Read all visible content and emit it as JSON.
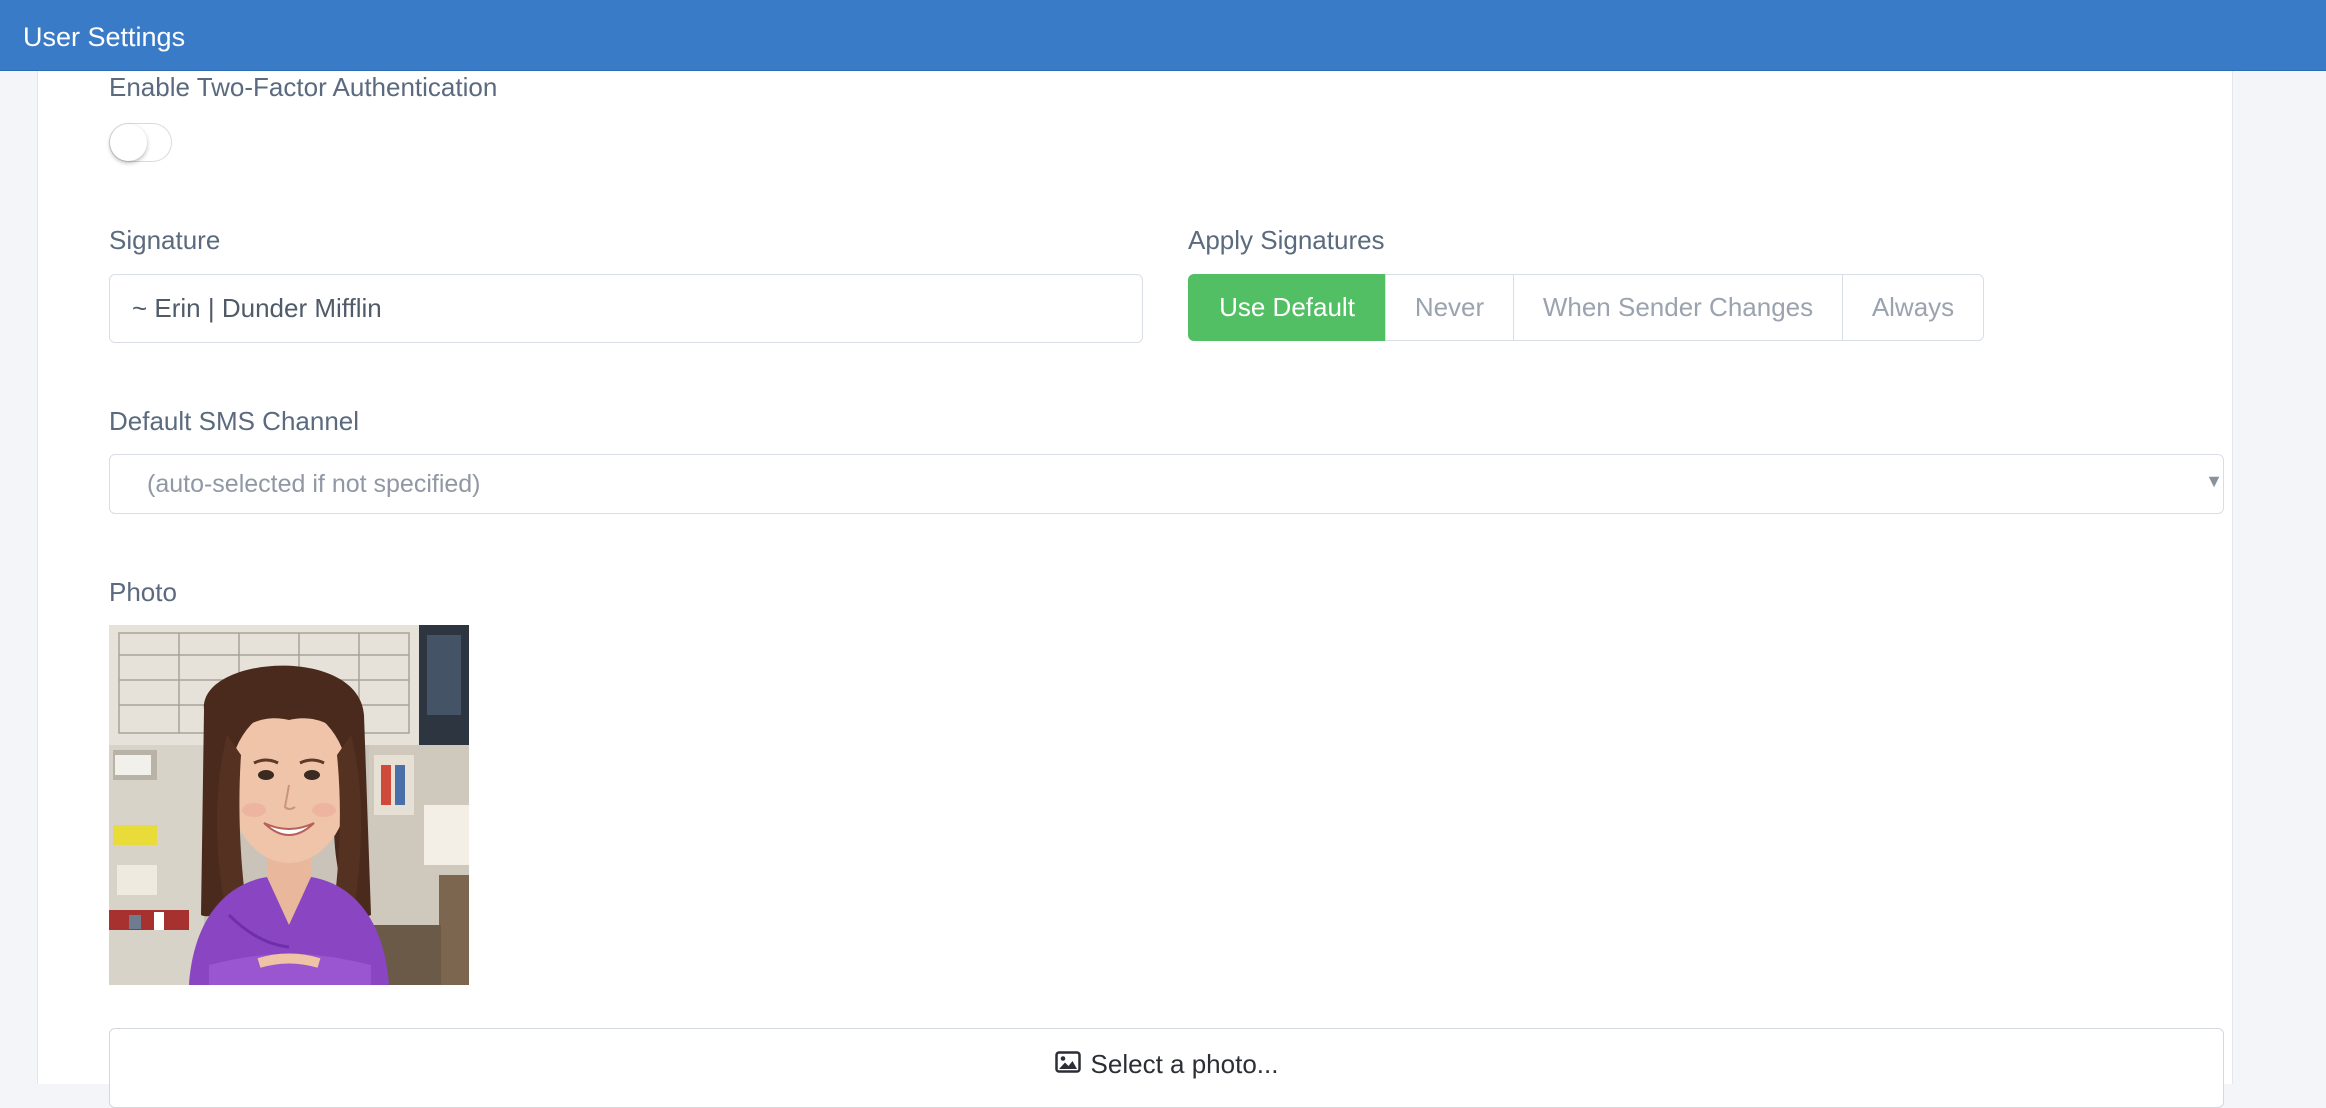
{
  "header": {
    "title": "User Settings"
  },
  "two_factor": {
    "label": "Enable Two-Factor Authentication",
    "enabled": false
  },
  "signature": {
    "label": "Signature",
    "value": "~ Erin | Dunder Mifflin"
  },
  "apply_signatures": {
    "label": "Apply Signatures",
    "options": [
      "Use Default",
      "Never",
      "When Sender Changes",
      "Always"
    ],
    "selected": "Use Default"
  },
  "sms_channel": {
    "label": "Default SMS Channel",
    "selected": "(auto-selected if not specified)",
    "arrow": "▼"
  },
  "photo": {
    "label": "Photo",
    "button_label": "Select a photo...",
    "button_icon": "image-icon"
  },
  "colors": {
    "header": "#3a7bc8",
    "active_option": "#52bf64"
  }
}
